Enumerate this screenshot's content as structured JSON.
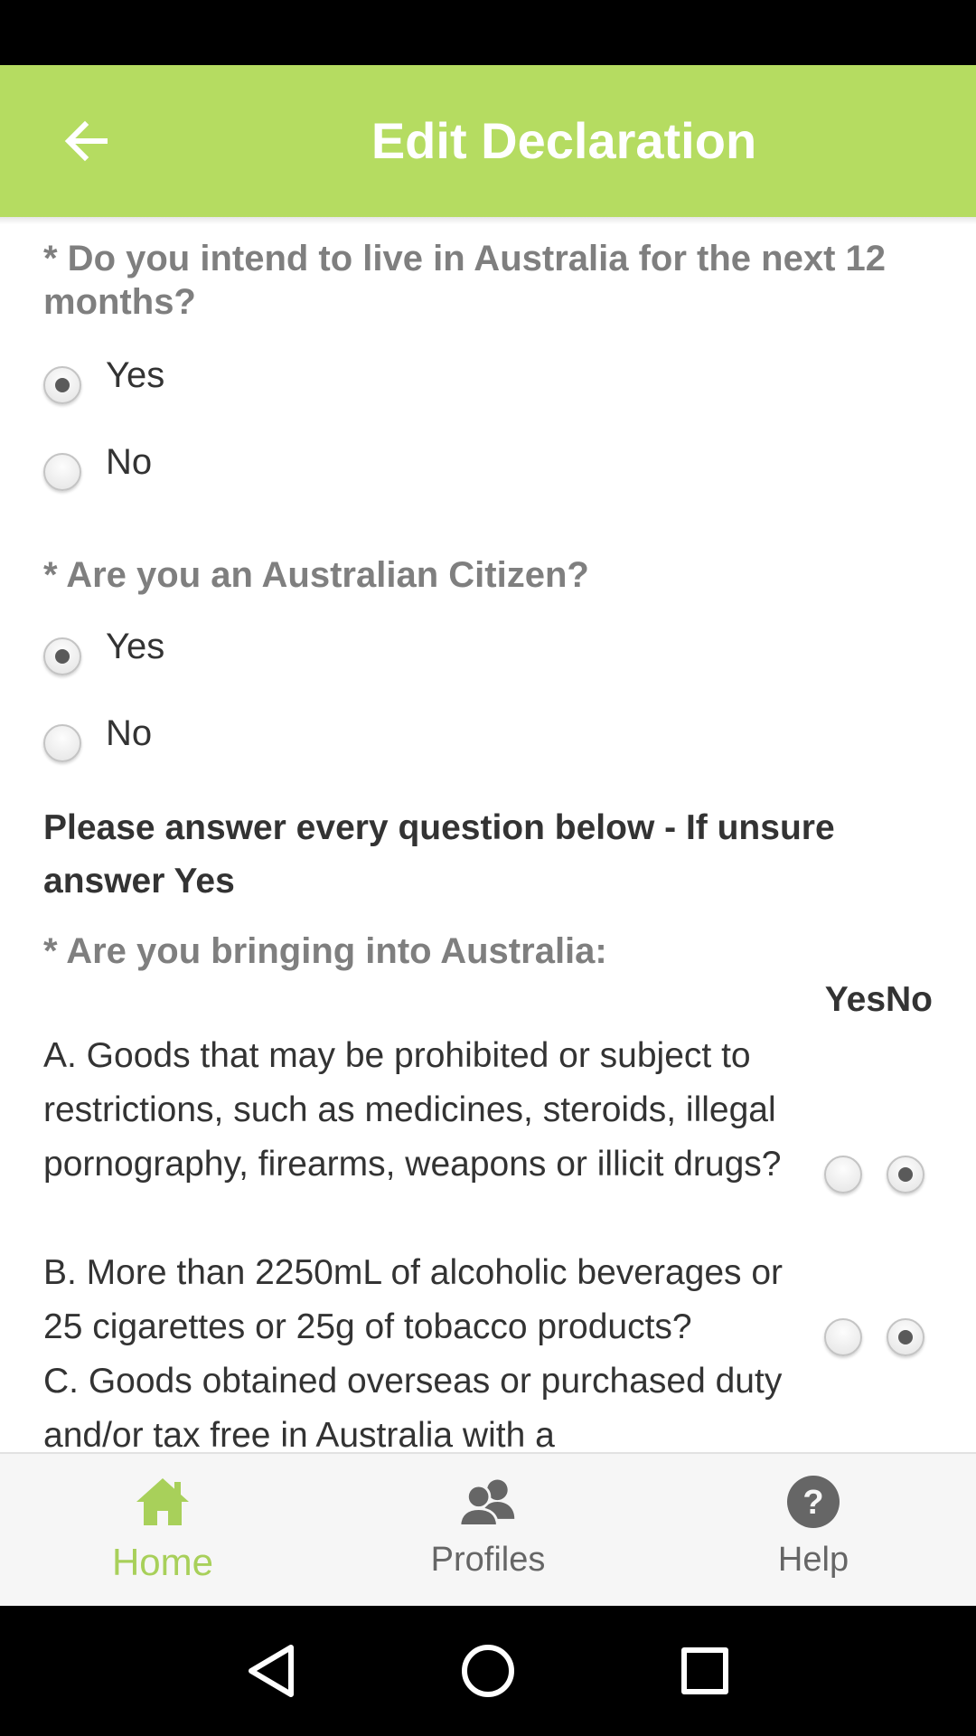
{
  "app_bar": {
    "title": "Edit Declaration",
    "color": "#b5dc61"
  },
  "questions": {
    "q1": {
      "label": "* Do you intend to live in Australia for the next 12 months?",
      "options": [
        {
          "label": "Yes",
          "checked": true
        },
        {
          "label": "No",
          "checked": false
        }
      ]
    },
    "q2": {
      "label": "* Are you an Australian Citizen?",
      "options": [
        {
          "label": "Yes",
          "checked": true
        },
        {
          "label": "No",
          "checked": false
        }
      ]
    }
  },
  "instruction": "Please answer every question below - If unsure answer Yes",
  "goods": {
    "label": "* Are you bringing into Australia:",
    "header": "YesNo",
    "items": [
      {
        "text": "A. Goods that may be prohibited or subject to restrictions, such as medicines, steroids, illegal pornography, firearms, weapons or illicit drugs?",
        "answer": "No"
      },
      {
        "text": "B. More than 2250mL of alcoholic beverages or 25 cigarettes or 25g of tobacco products?",
        "answer": "No"
      },
      {
        "text": "C. Goods obtained overseas or purchased duty and/or tax free in Australia with a",
        "answer": null
      }
    ]
  },
  "bottom_nav": {
    "items": [
      {
        "label": "Home",
        "icon": "home-icon",
        "active": true
      },
      {
        "label": "Profiles",
        "icon": "profiles-icon",
        "active": false
      },
      {
        "label": "Help",
        "icon": "help-icon",
        "active": false
      }
    ],
    "active_color": "#a8d05a"
  },
  "system_nav": [
    "back-triangle-icon",
    "home-circle-icon",
    "recents-square-icon"
  ]
}
